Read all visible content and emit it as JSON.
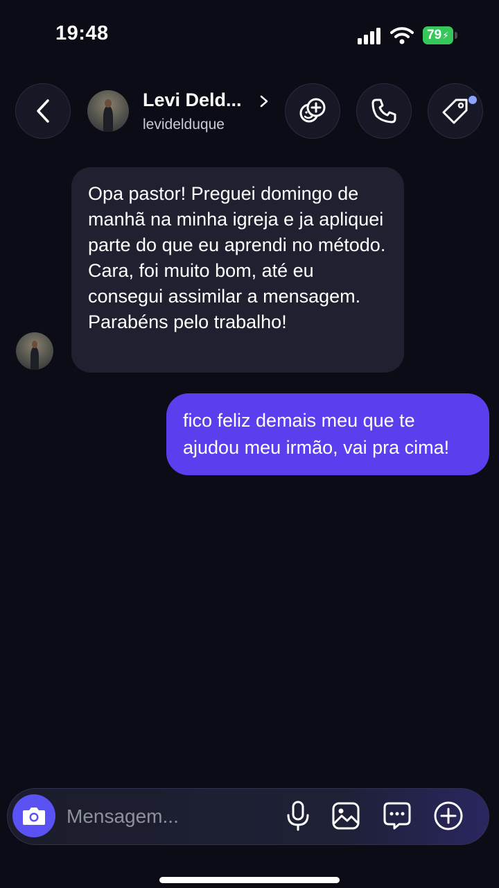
{
  "status_bar": {
    "time": "19:48",
    "battery": "79",
    "battery_color": "#35c759"
  },
  "header": {
    "contact_name": "Levi Deld...",
    "username": "levidelduque",
    "icons": [
      "back-icon",
      "effects-icon",
      "phone-icon",
      "tag-icon"
    ],
    "notification_dot_color": "#8ea2ff"
  },
  "messages": [
    {
      "direction": "incoming",
      "text": "Opa pastor! Preguei domingo de manhã na minha igreja e ja apliquei parte do que eu aprendi no método. Cara, foi muito bom, até eu consegui assimilar a mensagem. Parabéns pelo trabalho!",
      "bubble_color": "#1f2130"
    },
    {
      "direction": "outgoing",
      "text": "fico feliz demais meu que te ajudou meu irmão, vai pra cima!",
      "bubble_color": "#5b3fee"
    }
  ],
  "composer": {
    "placeholder": "Mensagem...",
    "value": "",
    "camera_color": "#5b52f3",
    "icons": [
      "camera-icon",
      "microphone-icon",
      "gallery-icon",
      "sticker-icon",
      "plus-icon"
    ]
  },
  "theme": {
    "background": "#0b0c16"
  }
}
